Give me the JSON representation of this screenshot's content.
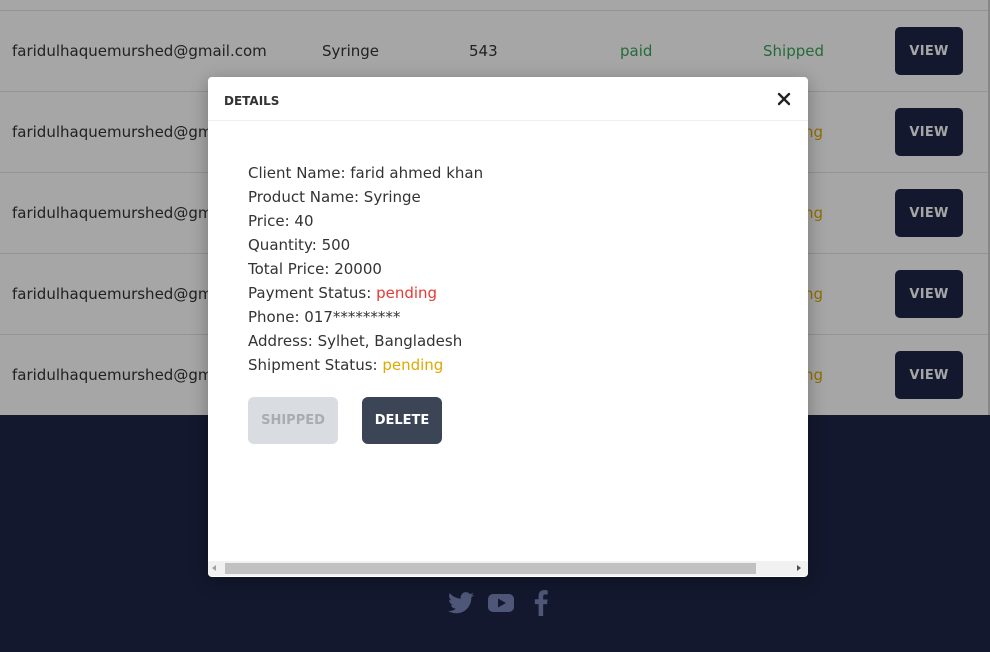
{
  "table": {
    "rows": [
      {
        "email": "faridulhaquemurshed@gmail.com",
        "product": "Syringe",
        "quantity": "543",
        "payment": "paid",
        "shipment": "Shipped",
        "view": "VIEW"
      },
      {
        "email": "faridulhaquemurshed@gma",
        "shipment": "ng",
        "view": "VIEW"
      },
      {
        "email": "faridulhaquemurshed@gma",
        "shipment": "ng",
        "view": "VIEW"
      },
      {
        "email": "faridulhaquemurshed@gma",
        "shipment": "ng",
        "view": "VIEW"
      },
      {
        "email": "faridulhaquemurshed@gma",
        "shipment": "ng",
        "view": "VIEW"
      }
    ]
  },
  "modal": {
    "title": "DETAILS",
    "close_icon": "close-icon",
    "client_label": "Client Name: ",
    "client_value": "farid ahmed khan",
    "product_label": "Product Name: ",
    "product_value": "Syringe",
    "price_label": "Price: ",
    "price_value": "40",
    "quantity_label": "Quantity: ",
    "quantity_value": "500",
    "total_label": "Total Price: ",
    "total_value": "20000",
    "payment_label": "Payment Status: ",
    "payment_value": "pending",
    "phone_label": "Phone: ",
    "phone_value": "017*********",
    "address_label": "Address: ",
    "address_value": "Sylhet, Bangladesh",
    "shipment_label": "Shipment Status: ",
    "shipment_value": "pending",
    "shipped_button": "SHIPPED",
    "delete_button": "DELETE"
  },
  "footer": {
    "icons": [
      "twitter-icon",
      "youtube-icon",
      "facebook-icon"
    ]
  },
  "colors": {
    "navy": "#1e2547",
    "paid_green": "#3aa35a",
    "pending_red": "#e53935",
    "pending_yellow": "#e0a800",
    "delete_button": "#3b4555"
  }
}
